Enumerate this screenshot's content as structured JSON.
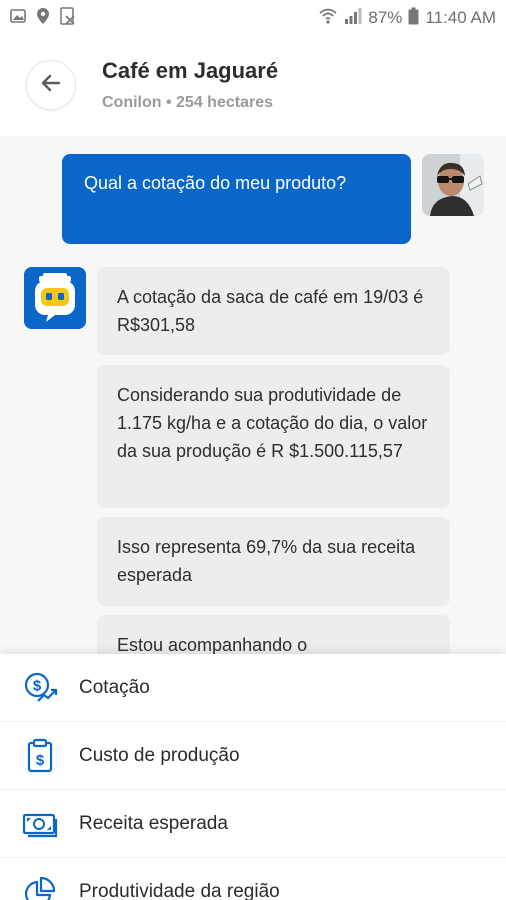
{
  "status_bar": {
    "battery": "87%",
    "time": "11:40 AM"
  },
  "header": {
    "title": "Café em Jaguaré",
    "subtitle": "Conilon • 254 hectares"
  },
  "chat": {
    "user_message": "Qual a cotação do meu produto?",
    "bot_messages": [
      "A cotação da saca de café em 19/03 é R$301,58",
      "Considerando sua produtividade de 1.175 kg/ha e a cotação do dia, o valor da sua produção é R $1.500.115,57",
      "Isso representa 69,7% da sua receita esperada",
      "Estou acompanhando o"
    ]
  },
  "menu": {
    "items": [
      {
        "label": "Cotação",
        "icon": "price-trend-icon"
      },
      {
        "label": "Custo de produção",
        "icon": "clipboard-dollar-icon"
      },
      {
        "label": "Receita esperada",
        "icon": "money-bill-icon"
      },
      {
        "label": "Produtividade da região",
        "icon": "pie-chart-icon"
      }
    ]
  },
  "colors": {
    "accent": "#0a66c9",
    "bubble_bot": "#ededed"
  }
}
